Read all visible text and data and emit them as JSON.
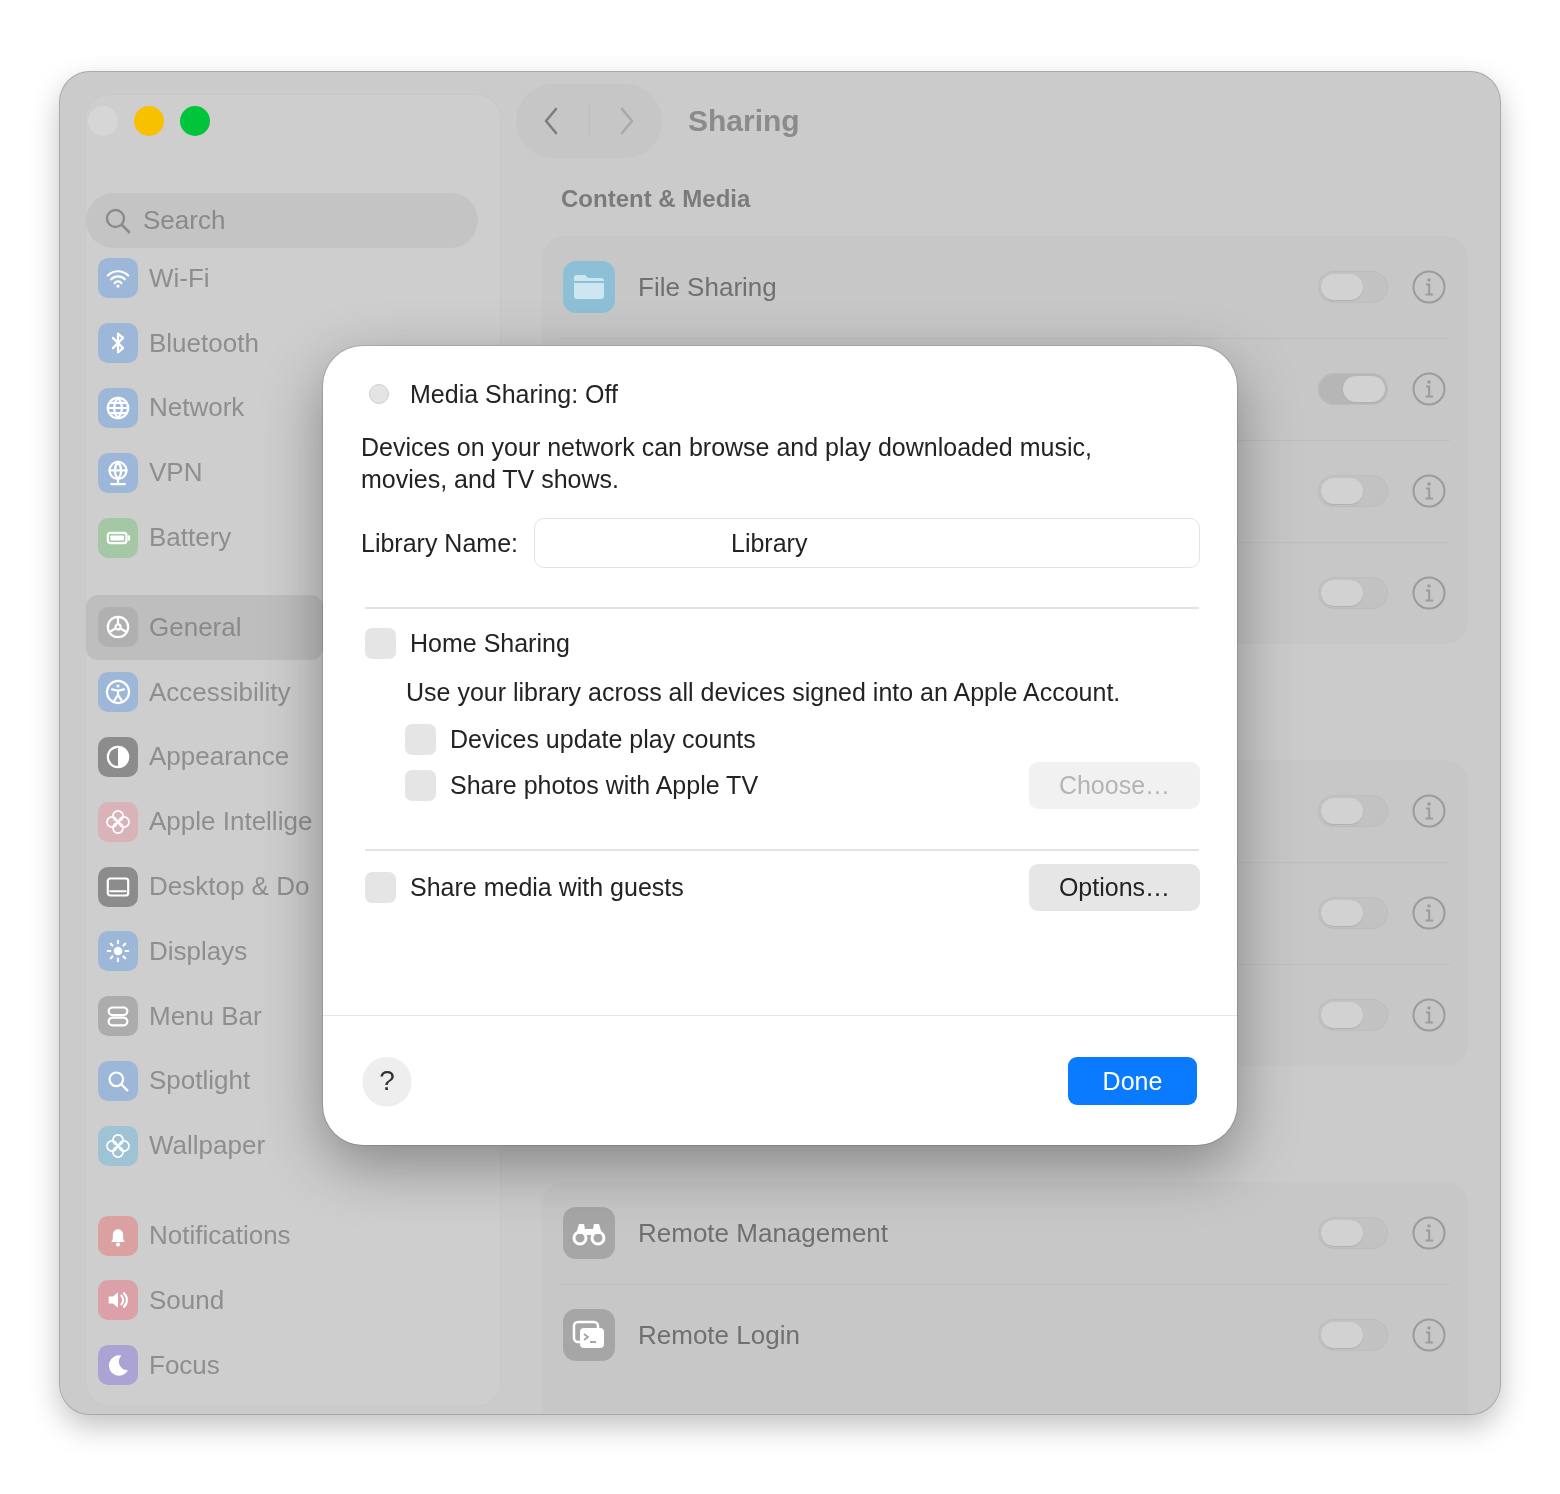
{
  "window": {
    "traffic_lights": [
      {
        "color": "#d6d6d6"
      },
      {
        "color": "#f8c100"
      },
      {
        "color": "#00c43a"
      }
    ]
  },
  "sidebar": {
    "search": {
      "placeholder": "Search"
    },
    "groups": [
      {
        "items": [
          {
            "label": "Wi-Fi",
            "color": "#9db7d8",
            "selected": false
          },
          {
            "label": "Bluetooth",
            "color": "#9db7d8",
            "selected": false
          },
          {
            "label": "Network",
            "color": "#9db7d8",
            "selected": false
          },
          {
            "label": "VPN",
            "color": "#9db7d8",
            "selected": false
          },
          {
            "label": "Battery",
            "color": "#a3c8a3",
            "selected": false
          }
        ]
      },
      {
        "items": [
          {
            "label": "General",
            "color": "#b0b0b0",
            "selected": true
          },
          {
            "label": "Accessibility",
            "color": "#9db7d8",
            "selected": false
          },
          {
            "label": "Appearance",
            "color": "#8c8c8c",
            "selected": false
          },
          {
            "label": "Apple Intellige",
            "color": "#d9b3b8",
            "selected": false
          },
          {
            "label": "Desktop & Do",
            "color": "#8c8c8c",
            "selected": false
          },
          {
            "label": "Displays",
            "color": "#9db7d8",
            "selected": false
          },
          {
            "label": "Menu Bar",
            "color": "#acacac",
            "selected": false
          },
          {
            "label": "Spotlight",
            "color": "#9db7d8",
            "selected": false
          },
          {
            "label": "Wallpaper",
            "color": "#9ec3d4",
            "selected": false
          }
        ]
      },
      {
        "items": [
          {
            "label": "Notifications",
            "color": "#dba0a0",
            "selected": false
          },
          {
            "label": "Sound",
            "color": "#dba0a8",
            "selected": false
          },
          {
            "label": "Focus",
            "color": "#aaa3d4",
            "selected": false
          }
        ]
      }
    ]
  },
  "pane": {
    "title": "Sharing",
    "back": {
      "disabled": false
    },
    "forward": {
      "disabled": true
    },
    "sections": [
      {
        "heading": "Content & Media",
        "rows": [
          {
            "label": "File Sharing",
            "color": "#8dc0d6",
            "on": false
          },
          {
            "on": true
          },
          {
            "on": false
          },
          {
            "on": false
          }
        ]
      },
      {
        "rows": [
          {
            "on": false
          },
          {
            "on": false
          },
          {
            "on": false
          }
        ]
      },
      {
        "rows": [
          {
            "label": "Remote Management",
            "color": "#a6a6a6",
            "on": false
          },
          {
            "label": "Remote Login",
            "color": "#a6a6a6",
            "on": false
          }
        ]
      }
    ]
  },
  "dialog": {
    "status": {
      "label": "Media Sharing: Off",
      "on": false
    },
    "description": "Devices on your network can browse and play downloaded music, movies, and TV shows.",
    "library_name": {
      "label": "Library Name:",
      "value": "Library"
    },
    "home_sharing": {
      "label": "Home Sharing",
      "checked": false,
      "description": "Use your library across all devices signed into an Apple Account.",
      "options": [
        {
          "label": "Devices update play counts",
          "checked": false
        },
        {
          "label": "Share photos with Apple TV",
          "checked": false
        }
      ]
    },
    "choose_button": {
      "label": "Choose…",
      "disabled": true
    },
    "guests": {
      "label": "Share media with guests",
      "checked": false
    },
    "options_button": {
      "label": "Options…",
      "disabled": false
    },
    "help_button": "?",
    "done_button": "Done"
  }
}
